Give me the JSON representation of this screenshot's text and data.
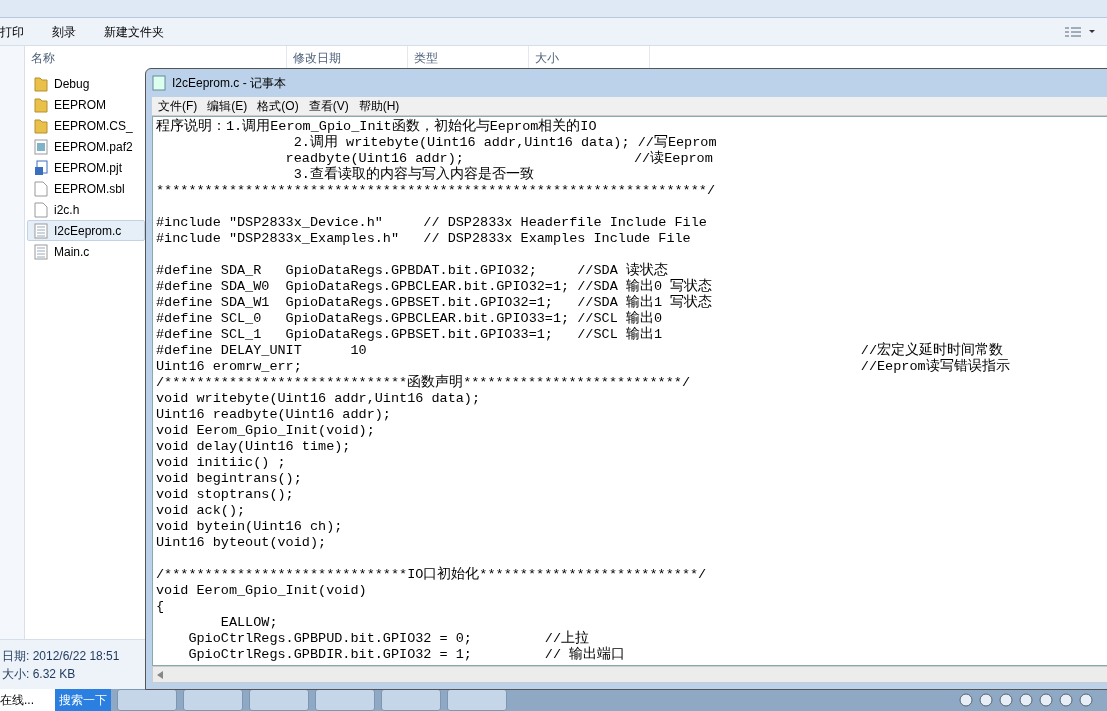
{
  "explorer": {
    "toolbar": [
      "打印",
      "刻录",
      "新建文件夹"
    ],
    "columns": [
      "名称",
      "修改日期",
      "类型",
      "大小"
    ],
    "files": [
      {
        "name": "Debug",
        "kind": "folder",
        "selected": false
      },
      {
        "name": "EEPROM",
        "kind": "folder",
        "selected": false
      },
      {
        "name": "EEPROM.CS_",
        "kind": "folder",
        "selected": false
      },
      {
        "name": "EEPROM.paf2",
        "kind": "image",
        "selected": false
      },
      {
        "name": "EEPROM.pjt",
        "kind": "project",
        "selected": false
      },
      {
        "name": "EEPROM.sbl",
        "kind": "blank",
        "selected": false
      },
      {
        "name": "i2c.h",
        "kind": "blank",
        "selected": false
      },
      {
        "name": "I2cEeprom.c",
        "kind": "text",
        "selected": true
      },
      {
        "name": "Main.c",
        "kind": "text",
        "selected": false
      }
    ],
    "details": [
      "日期: 2012/6/22 18:51",
      "大小: 6.32 KB"
    ]
  },
  "notepad": {
    "title": "I2cEeprom.c - 记事本",
    "menu": [
      "文件(F)",
      "编辑(E)",
      "格式(O)",
      "查看(V)",
      "帮助(H)"
    ],
    "blocks": [
      [
        "程序说明：1.调用Eerom_Gpio_Init函数，初始化与Eeprom相关的IO",
        "                 2.调用 writebyte(Uint16 addr,Uint16 data); //写Eeprom",
        "                readbyte(Uint16 addr);                     //读Eeprom",
        "                 3.查看读取的内容与写入内容是否一致",
        "********************************************************************/"
      ],
      [
        "#include \"DSP2833x_Device.h\"     // DSP2833x Headerfile Include File",
        "#include \"DSP2833x_Examples.h\"   // DSP2833x Examples Include File"
      ],
      [
        "#define SDA_R   GpioDataRegs.GPBDAT.bit.GPIO32;     //SDA 读状态",
        "#define SDA_W0  GpioDataRegs.GPBCLEAR.bit.GPIO32=1; //SDA 输出0 写状态",
        "#define SDA_W1  GpioDataRegs.GPBSET.bit.GPIO32=1;   //SDA 输出1 写状态",
        "#define SCL_0   GpioDataRegs.GPBCLEAR.bit.GPIO33=1; //SCL 输出0",
        "#define SCL_1   GpioDataRegs.GPBSET.bit.GPIO33=1;   //SCL 输出1",
        "#define DELAY_UNIT      10                                                             //宏定义延时时间常数",
        "Uint16 eromrw_err;                                                                     //Eeprom读写错误指示",
        "/******************************函数声明***************************/",
        "void writebyte(Uint16 addr,Uint16 data);",
        "Uint16 readbyte(Uint16 addr);",
        "void Eerom_Gpio_Init(void);",
        "void delay(Uint16 time);",
        "void initiic() ;",
        "void begintrans();",
        "void stoptrans();",
        "void ack();",
        "void bytein(Uint16 ch);",
        "Uint16 byteout(void);"
      ],
      [
        "/******************************IO口初始化***************************/",
        "void Eerom_Gpio_Init(void)",
        "{",
        "        EALLOW;",
        "    GpioCtrlRegs.GPBPUD.bit.GPIO32 = 0;         //上拉",
        "    GpioCtrlRegs.GPBDIR.bit.GPIO32 = 1;         // 输出端口"
      ]
    ]
  },
  "taskbar": {
    "search_text": "在线...",
    "search_button": "搜索一下"
  }
}
